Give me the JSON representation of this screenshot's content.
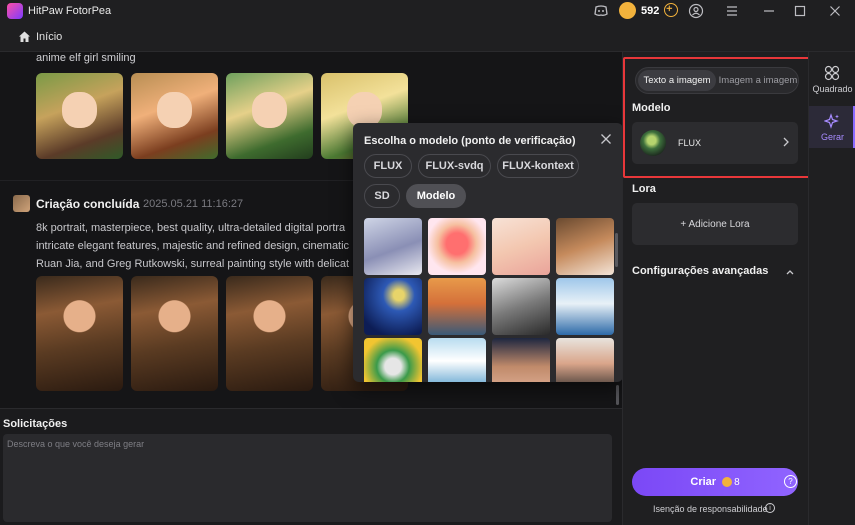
{
  "app": {
    "title": "HitPaw FotorPea",
    "credits": "592"
  },
  "breadcrumb": {
    "home_label": "Início"
  },
  "feed": {
    "prev_prompt": "anime elf girl smiling",
    "result_title": "Criação concluída",
    "result_time": "2025.05.21  11:16:27",
    "result_desc": [
      "8k portrait, masterpiece, best quality, ultra-detailed digital portra",
      "intricate elegant features, majestic and refined design, cinematic",
      "Ruan Jia, and Greg Rutkowski, surreal painting style with delicat"
    ]
  },
  "model_popup": {
    "title": "Escolha o modelo (ponto de verificação)",
    "chips": [
      "FLUX",
      "FLUX-svdq",
      "FLUX-kontext",
      "SD",
      "Modelo"
    ],
    "active_chip": "Modelo"
  },
  "prompt": {
    "label": "Solicitações",
    "placeholder": "Descreva o que você deseja gerar",
    "value": ""
  },
  "settings": {
    "mode_text": "Texto a imagem",
    "mode_image": "Imagem a imagem",
    "model_label": "Modelo",
    "model_name": "FLUX",
    "lora_label": "Lora",
    "add_lora": "+ Adicione Lora",
    "advanced_label": "Configurações avançadas",
    "create_label": "Criar",
    "create_cost": "8",
    "disclaimer": "Isenção de responsabilidade"
  },
  "rightnav": {
    "items": [
      {
        "label": "Quadrado",
        "icon": "grid-icon"
      },
      {
        "label": "Gerar",
        "icon": "sparkle-icon"
      }
    ]
  },
  "colors": {
    "accent": "#8b6cff",
    "highlight": "#e8373a",
    "coin": "#f2b23c"
  }
}
